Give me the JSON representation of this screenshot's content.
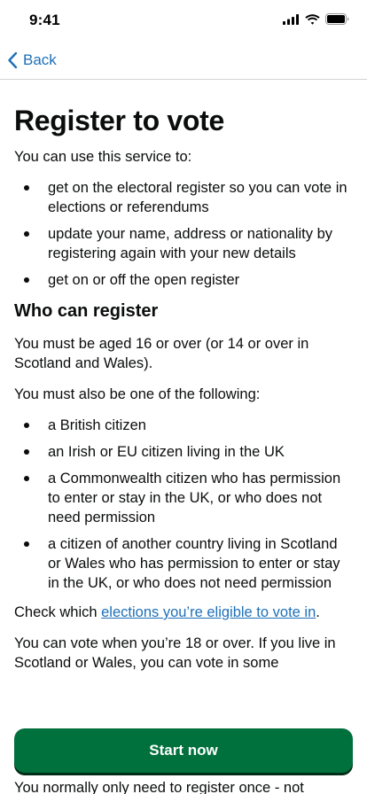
{
  "status_bar": {
    "time": "9:41"
  },
  "nav": {
    "back_label": "Back"
  },
  "page": {
    "title": "Register to vote",
    "intro": "You can use this service to:",
    "uses": [
      "get on the electoral register so you can vote in elections or referendums",
      "update your name, address or nationality by registering again with your new details",
      "get on or off the open register"
    ],
    "who_heading": "Who can register",
    "age_text": "You must be aged 16 or over (or 14 or over in Scotland and Wales).",
    "also_text": "You must also be one of the following:",
    "eligibility": [
      "a British citizen",
      "an Irish or EU citizen living in the UK",
      "a Commonwealth citizen who has permission to enter or stay in the UK, or who does not need permission",
      "a citizen of another country living in Scotland or Wales who has permission to enter or stay in the UK, or who does not need permission"
    ],
    "check_prefix": "Check which ",
    "check_link": "elections you’re eligible to vote in",
    "check_suffix": ".",
    "vote_age_text": "You can vote when you’re 18 or over. If you live in Scotland or Wales, you can vote in some",
    "bottom_text": "You normally only need to register once - not"
  },
  "actions": {
    "start_label": "Start now"
  }
}
